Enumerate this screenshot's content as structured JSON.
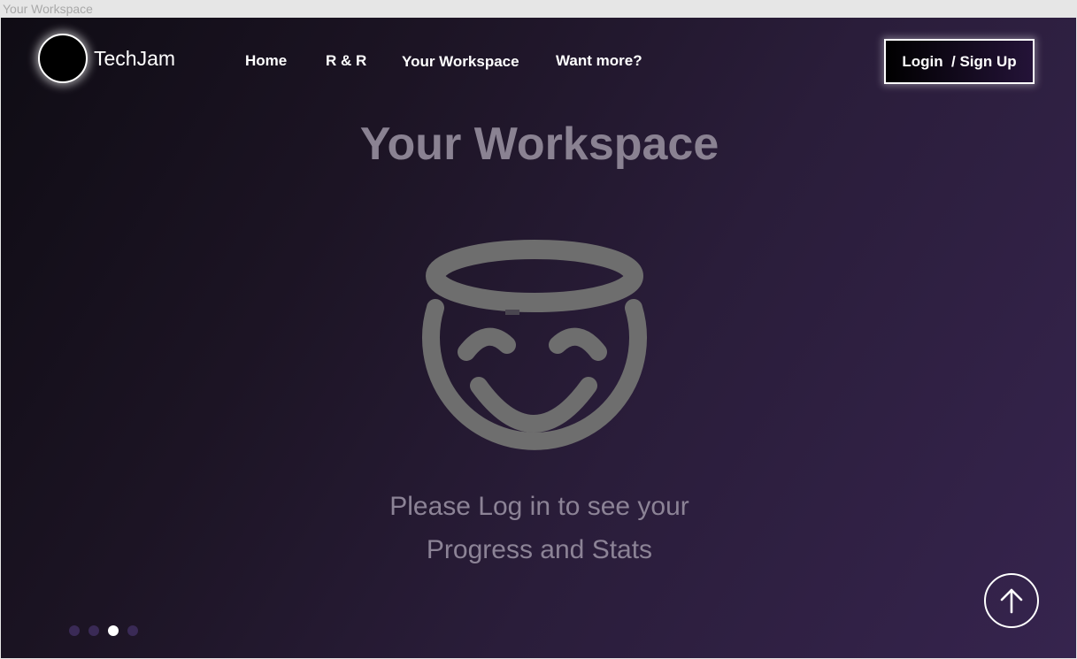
{
  "window": {
    "title": "Your Workspace"
  },
  "header": {
    "brand": "TechJam",
    "nav": [
      {
        "label": "Home"
      },
      {
        "label": "R & R"
      },
      {
        "label": "Your Workspace"
      },
      {
        "label": "Want more?"
      }
    ],
    "login_label": "Login  / Sign Up"
  },
  "main": {
    "title": "Your Workspace",
    "illustration_icon": "smiling-face-with-halo-icon",
    "message_line1": "Please Log in to see your",
    "message_line2": "Progress and Stats"
  },
  "footer": {
    "scroll_top_icon": "arrow-up-circle-icon",
    "pagination": {
      "total": 4,
      "active_index": 2
    }
  },
  "colors": {
    "accent_purple": "#36244e",
    "icon_gray": "#6e6e6e",
    "text_muted": "#8a8292"
  }
}
